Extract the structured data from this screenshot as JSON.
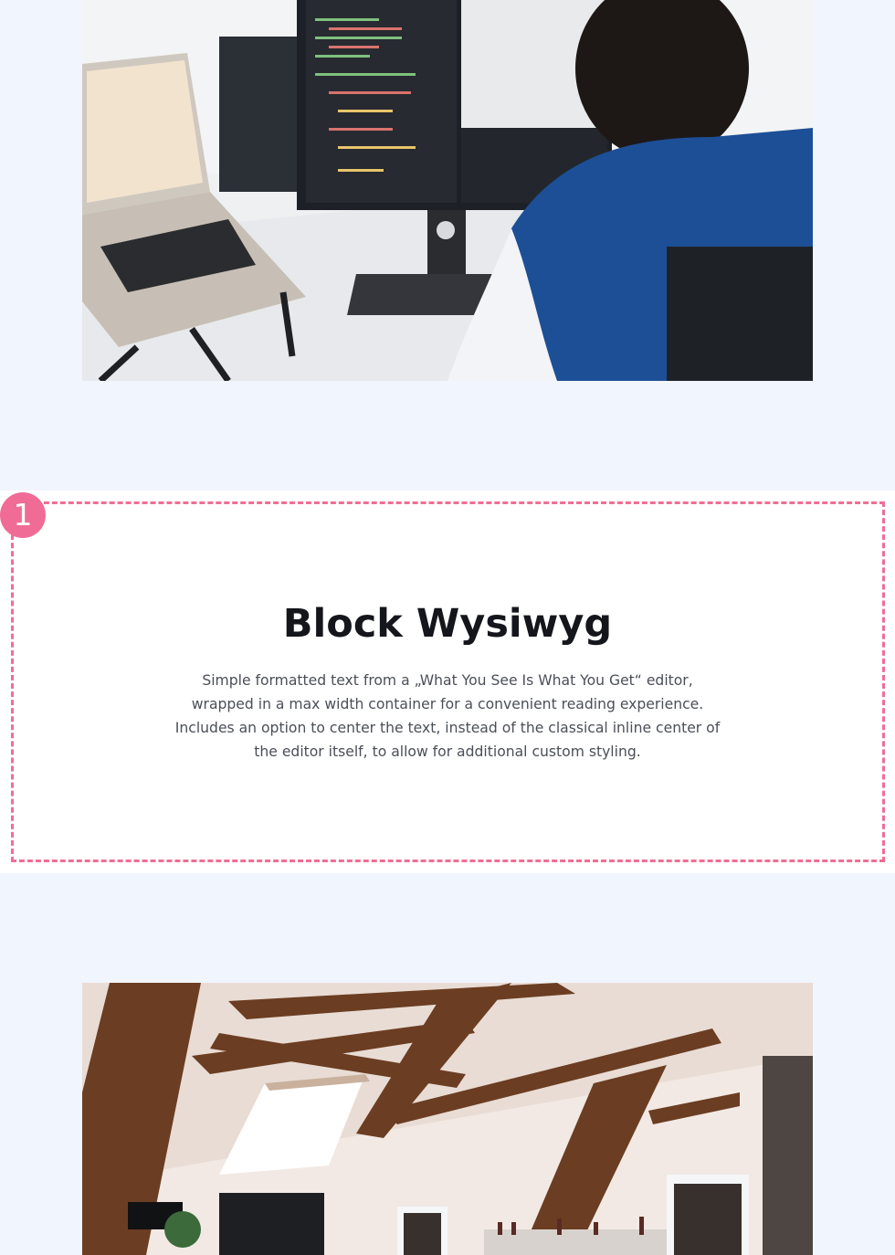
{
  "images": {
    "top_photo": {
      "icon": "developer-at-desk-photo"
    },
    "bottom_photo": {
      "icon": "attic-office-kitchen-photo"
    }
  },
  "block": {
    "badge_number": "1",
    "title": "Block Wysiwyg",
    "description": "Simple formatted text from a „What You See Is What You Get“ editor, wrapped in a max width container for a convenient reading experience. Includes an option to center the text, instead of the classical inline center of the editor itself, to allow for additional custom styling."
  },
  "colors": {
    "page_background": "#f1f5fe",
    "block_background": "#ffffff",
    "accent_pink": "#f06c96",
    "heading": "#14161c",
    "body_text": "#4b4f57"
  }
}
